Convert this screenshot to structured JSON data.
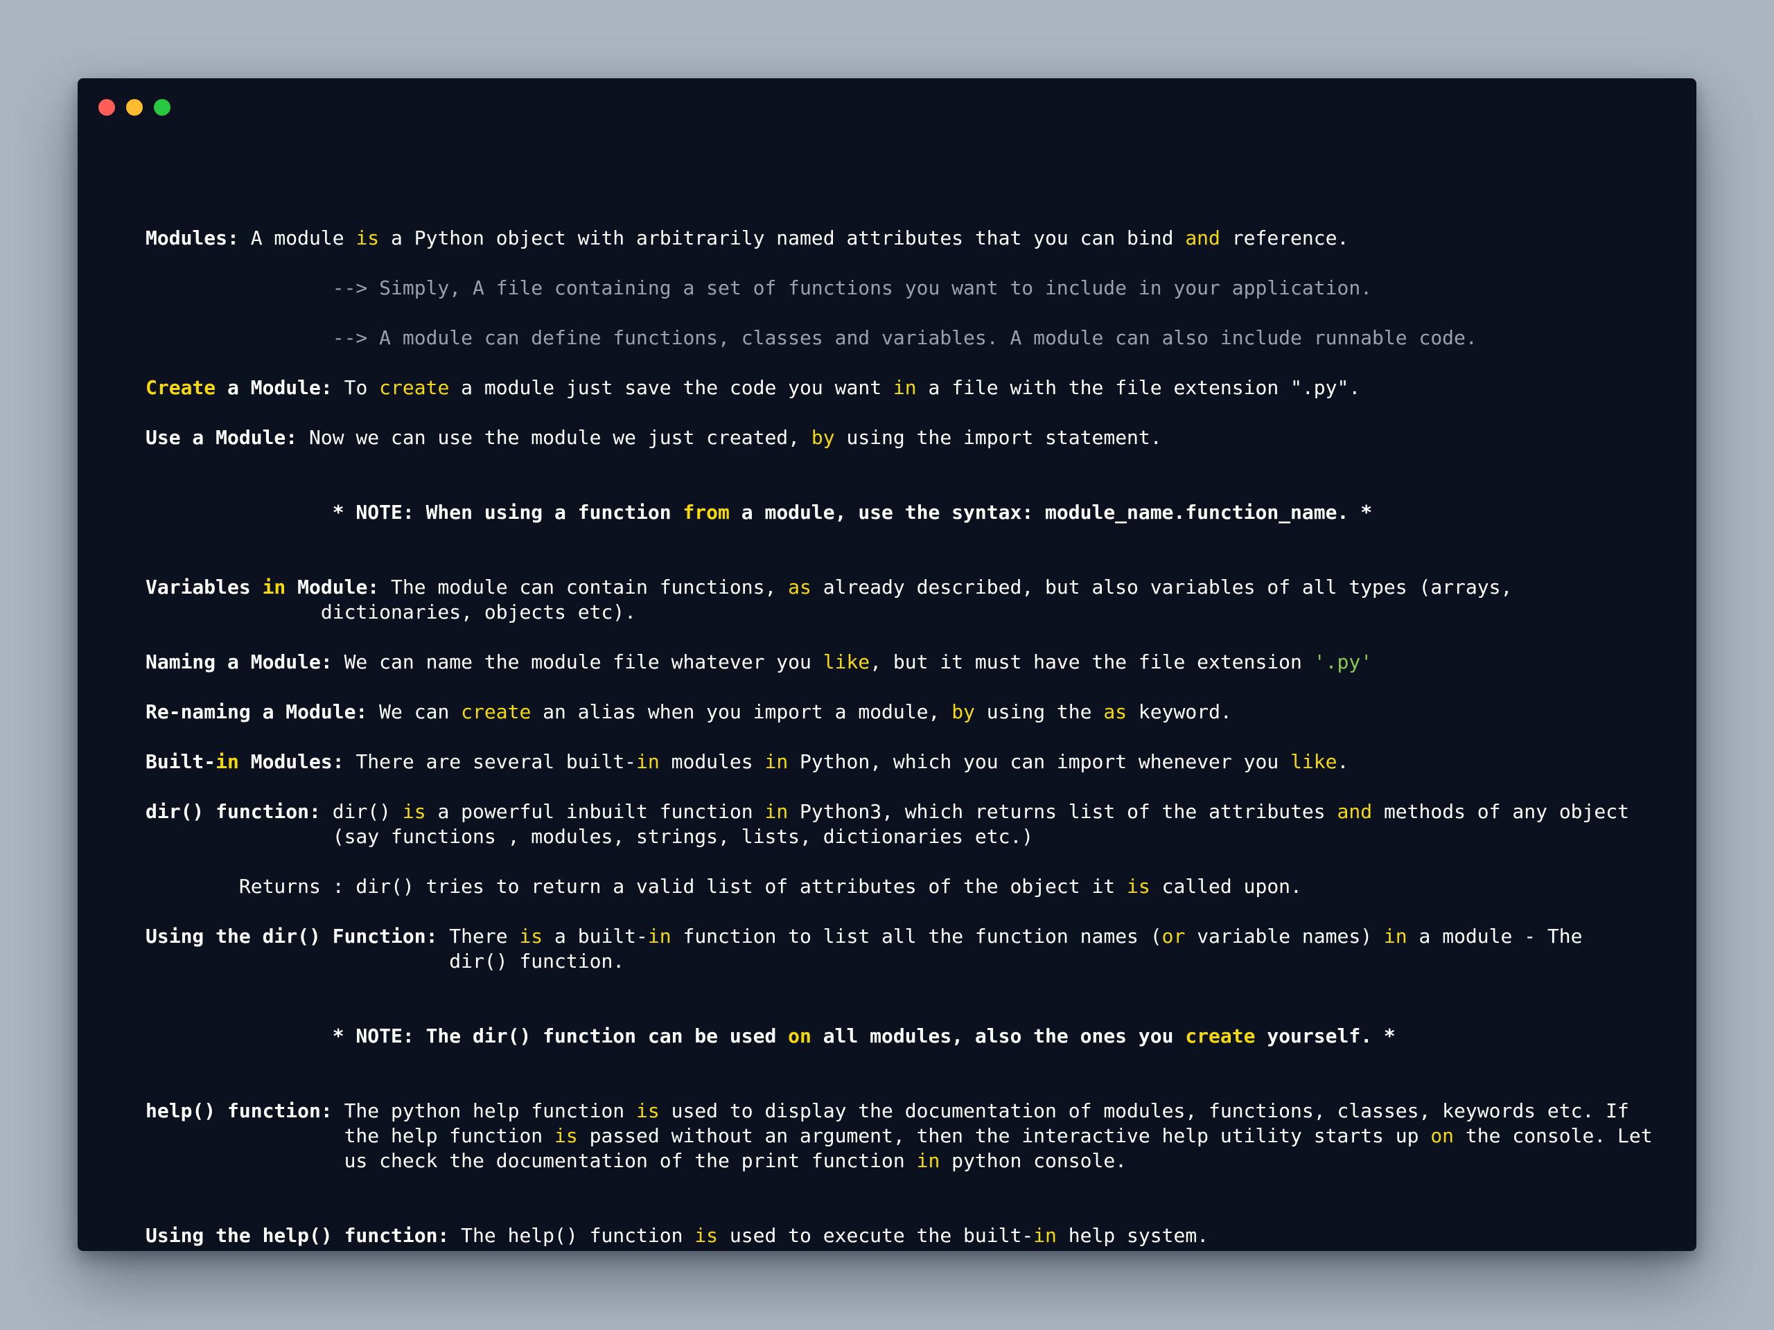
{
  "window": {
    "controls": [
      "close",
      "minimize",
      "maximize"
    ],
    "colors": {
      "background": "#0c1120",
      "text": "#ffffff",
      "keyword": "#f5d90a",
      "comment": "#9aa1ac",
      "string": "#8cc751",
      "close": "#ff5f57",
      "minimize": "#febc2e",
      "maximize": "#28c840"
    }
  },
  "lines": [
    {
      "id": "l1",
      "segments": [
        [
          "Modules:",
          "b"
        ],
        [
          " A module ",
          ""
        ],
        [
          "is",
          "kw"
        ],
        [
          " a Python object with arbitrarily named attributes that you can bind ",
          ""
        ],
        [
          "and",
          "kw"
        ],
        [
          " reference.",
          ""
        ]
      ]
    },
    {
      "id": "l2",
      "segments": [
        [
          "                --> Simply, A file containing a set of functions you want to include in your application.",
          "grey"
        ]
      ]
    },
    {
      "id": "l3",
      "segments": [
        [
          "                --> A module can define functions, classes and variables. A module can also include runnable code.",
          "grey"
        ]
      ]
    },
    {
      "id": "l4",
      "segments": [
        [
          "Create",
          "b kw"
        ],
        [
          " a Module:",
          "b"
        ],
        [
          " To ",
          ""
        ],
        [
          "create",
          "kw"
        ],
        [
          " a module just save the code you want ",
          ""
        ],
        [
          "in",
          "kw"
        ],
        [
          " a file with the file extension \".py\".",
          ""
        ]
      ]
    },
    {
      "id": "l5",
      "segments": [
        [
          "Use a Module:",
          "b"
        ],
        [
          " Now we can use the module we just created, ",
          ""
        ],
        [
          "by",
          "kw"
        ],
        [
          " using the import statement.",
          ""
        ]
      ]
    },
    {
      "id": "l6",
      "segments": [
        [
          "                * NOTE: When using a function ",
          "b"
        ],
        [
          "from",
          "b kw"
        ],
        [
          " a module, use the syntax: module_name.function_name. *",
          "b"
        ]
      ]
    },
    {
      "id": "l7",
      "segments": [
        [
          "Variables ",
          "b"
        ],
        [
          "in",
          "b kw"
        ],
        [
          " Module:",
          "b"
        ],
        [
          " The module can contain functions, ",
          ""
        ],
        [
          "as",
          "kw"
        ],
        [
          " already described, but also variables of all types (arrays,",
          ""
        ]
      ]
    },
    {
      "id": "l8",
      "segments": [
        [
          "               dictionaries, objects etc).",
          ""
        ]
      ]
    },
    {
      "id": "l9",
      "segments": [
        [
          "Naming a Module:",
          "b"
        ],
        [
          " We can name the module file whatever you ",
          ""
        ],
        [
          "like",
          "kw"
        ],
        [
          ", but it must have the file extension ",
          ""
        ],
        [
          "'.py'",
          "str"
        ]
      ]
    },
    {
      "id": "l10",
      "segments": [
        [
          "Re-naming a Module:",
          "b"
        ],
        [
          " We can ",
          ""
        ],
        [
          "create",
          "kw"
        ],
        [
          " an alias when you import a module, ",
          ""
        ],
        [
          "by",
          "kw"
        ],
        [
          " using the ",
          ""
        ],
        [
          "as",
          "kw"
        ],
        [
          " keyword.",
          ""
        ]
      ]
    },
    {
      "id": "l11",
      "segments": [
        [
          "Built-",
          "b"
        ],
        [
          "in",
          "b kw"
        ],
        [
          " Modules:",
          "b"
        ],
        [
          " There are several built-",
          ""
        ],
        [
          "in",
          "kw"
        ],
        [
          " modules ",
          ""
        ],
        [
          "in",
          "kw"
        ],
        [
          " Python, which you can import whenever you ",
          ""
        ],
        [
          "like",
          "kw"
        ],
        [
          ".",
          ""
        ]
      ]
    },
    {
      "id": "l12",
      "segments": [
        [
          "dir() function:",
          "b"
        ],
        [
          " dir() ",
          ""
        ],
        [
          "is",
          "kw"
        ],
        [
          " a powerful inbuilt function ",
          ""
        ],
        [
          "in",
          "kw"
        ],
        [
          " Python3, which returns list of the attributes ",
          ""
        ],
        [
          "and",
          "kw"
        ],
        [
          " methods of any object",
          ""
        ]
      ]
    },
    {
      "id": "l13",
      "segments": [
        [
          "                (say functions , modules, strings, lists, dictionaries etc.)",
          ""
        ]
      ]
    },
    {
      "id": "l14",
      "segments": [
        [
          "        Returns : dir() tries to return a valid list of attributes of the object it ",
          ""
        ],
        [
          "is",
          "kw"
        ],
        [
          " called upon.",
          ""
        ]
      ]
    },
    {
      "id": "l15",
      "segments": [
        [
          "Using the dir() Function:",
          "b"
        ],
        [
          " There ",
          ""
        ],
        [
          "is",
          "kw"
        ],
        [
          " a built-",
          ""
        ],
        [
          "in",
          "kw"
        ],
        [
          " function to list all the function names (",
          ""
        ],
        [
          "or",
          "kw"
        ],
        [
          " variable names) ",
          ""
        ],
        [
          "in",
          "kw"
        ],
        [
          " a module - The",
          ""
        ]
      ]
    },
    {
      "id": "l16",
      "segments": [
        [
          "                          dir() function.",
          ""
        ]
      ]
    },
    {
      "id": "l17",
      "segments": [
        [
          "                * NOTE: The dir() function can be used ",
          "b"
        ],
        [
          "on",
          "b kw"
        ],
        [
          " all modules, also the ones you ",
          "b"
        ],
        [
          "create",
          "b kw"
        ],
        [
          " yourself. *",
          "b"
        ]
      ]
    },
    {
      "id": "l18",
      "segments": [
        [
          "help() function:",
          "b"
        ],
        [
          " The python help function ",
          ""
        ],
        [
          "is",
          "kw"
        ],
        [
          " used to display the documentation of modules, functions, classes, keywords etc. If",
          ""
        ]
      ]
    },
    {
      "id": "l19",
      "segments": [
        [
          "                 the help function ",
          ""
        ],
        [
          "is",
          "kw"
        ],
        [
          " passed without an argument, then the interactive help utility starts up ",
          ""
        ],
        [
          "on",
          "kw"
        ],
        [
          " the console. Let",
          ""
        ]
      ]
    },
    {
      "id": "l20",
      "segments": [
        [
          "                 us check the documentation of the print function ",
          ""
        ],
        [
          "in",
          "kw"
        ],
        [
          " python console.",
          ""
        ]
      ]
    },
    {
      "id": "l21",
      "segments": [
        [
          "Using the help() function:",
          "b"
        ],
        [
          " The help() function ",
          ""
        ],
        [
          "is",
          "kw"
        ],
        [
          " used to execute the built-",
          ""
        ],
        [
          "in",
          "kw"
        ],
        [
          " help system.",
          ""
        ]
      ]
    }
  ]
}
